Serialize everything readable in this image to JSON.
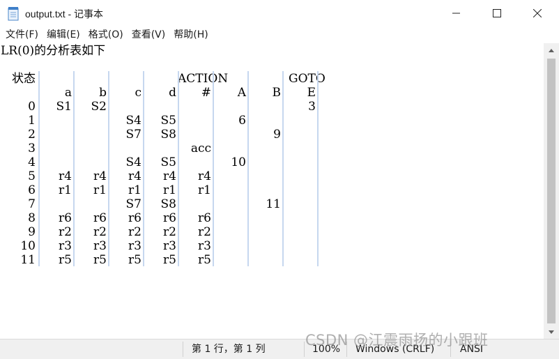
{
  "window": {
    "title": "output.txt - 记事本",
    "icon": "notepad-icon",
    "controls": [
      "minimize-icon",
      "maximize-icon",
      "close-icon"
    ]
  },
  "menu": [
    "文件(F)",
    "编辑(E)",
    "格式(O)",
    "查看(V)",
    "帮助(H)"
  ],
  "document": {
    "intro": "LR(0)的分析表如下",
    "table": {
      "state_header": "状态",
      "action_header": "ACTION",
      "goto_header": "GOTO",
      "action_columns": [
        "a",
        "b",
        "c",
        "d",
        "#"
      ],
      "goto_columns": [
        "A",
        "B",
        "E"
      ],
      "rows": [
        {
          "state": "0",
          "cells": [
            "S1",
            "S2",
            "",
            "",
            "",
            "",
            "",
            "3"
          ]
        },
        {
          "state": "1",
          "cells": [
            "",
            "",
            "S4",
            "S5",
            "",
            "6",
            "",
            ""
          ]
        },
        {
          "state": "2",
          "cells": [
            "",
            "",
            "S7",
            "S8",
            "",
            "",
            "9",
            ""
          ]
        },
        {
          "state": "3",
          "cells": [
            "",
            "",
            "",
            "",
            "acc",
            "",
            "",
            ""
          ]
        },
        {
          "state": "4",
          "cells": [
            "",
            "",
            "S4",
            "S5",
            "",
            "10",
            "",
            ""
          ]
        },
        {
          "state": "5",
          "cells": [
            "r4",
            "r4",
            "r4",
            "r4",
            "r4",
            "",
            "",
            ""
          ]
        },
        {
          "state": "6",
          "cells": [
            "r1",
            "r1",
            "r1",
            "r1",
            "r1",
            "",
            "",
            ""
          ]
        },
        {
          "state": "7",
          "cells": [
            "",
            "",
            "S7",
            "S8",
            "",
            "",
            "11",
            ""
          ]
        },
        {
          "state": "8",
          "cells": [
            "r6",
            "r6",
            "r6",
            "r6",
            "r6",
            "",
            "",
            ""
          ]
        },
        {
          "state": "9",
          "cells": [
            "r2",
            "r2",
            "r2",
            "r2",
            "r2",
            "",
            "",
            ""
          ]
        },
        {
          "state": "10",
          "cells": [
            "r3",
            "r3",
            "r3",
            "r3",
            "r3",
            "",
            "",
            ""
          ]
        },
        {
          "state": "11",
          "cells": [
            "r5",
            "r5",
            "r5",
            "r5",
            "r5",
            "",
            "",
            ""
          ]
        }
      ]
    }
  },
  "status": {
    "position": "第 1 行，第 1 列",
    "zoom": "100%",
    "line_ending": "Windows (CRLF)",
    "encoding": "ANSI"
  },
  "watermark": "CSDN @江震雨扬的小跟班",
  "colors": {
    "tab_guides": "#c6d7ef",
    "statusbar_bg": "#f0f0f0"
  }
}
